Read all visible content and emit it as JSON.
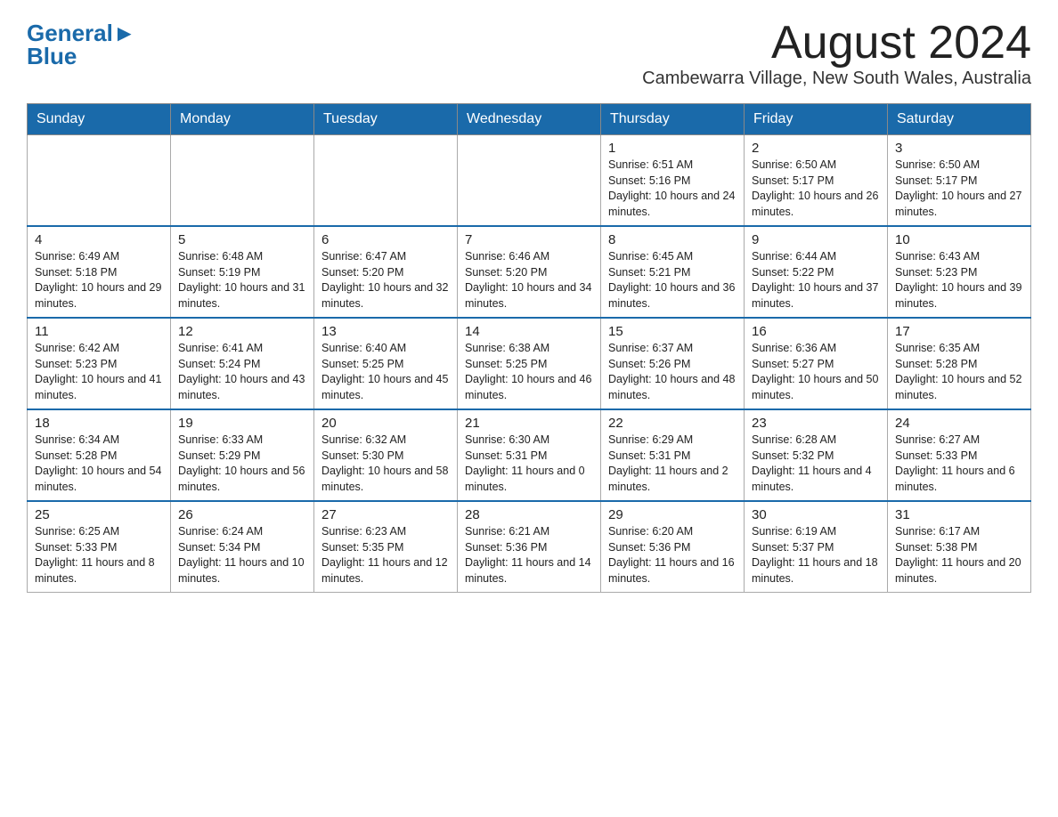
{
  "header": {
    "logo_general": "General",
    "logo_blue": "Blue",
    "month_title": "August 2024",
    "location": "Cambewarra Village, New South Wales, Australia"
  },
  "days_of_week": [
    "Sunday",
    "Monday",
    "Tuesday",
    "Wednesday",
    "Thursday",
    "Friday",
    "Saturday"
  ],
  "weeks": [
    [
      {
        "day": "",
        "info": ""
      },
      {
        "day": "",
        "info": ""
      },
      {
        "day": "",
        "info": ""
      },
      {
        "day": "",
        "info": ""
      },
      {
        "day": "1",
        "info": "Sunrise: 6:51 AM\nSunset: 5:16 PM\nDaylight: 10 hours and 24 minutes."
      },
      {
        "day": "2",
        "info": "Sunrise: 6:50 AM\nSunset: 5:17 PM\nDaylight: 10 hours and 26 minutes."
      },
      {
        "day": "3",
        "info": "Sunrise: 6:50 AM\nSunset: 5:17 PM\nDaylight: 10 hours and 27 minutes."
      }
    ],
    [
      {
        "day": "4",
        "info": "Sunrise: 6:49 AM\nSunset: 5:18 PM\nDaylight: 10 hours and 29 minutes."
      },
      {
        "day": "5",
        "info": "Sunrise: 6:48 AM\nSunset: 5:19 PM\nDaylight: 10 hours and 31 minutes."
      },
      {
        "day": "6",
        "info": "Sunrise: 6:47 AM\nSunset: 5:20 PM\nDaylight: 10 hours and 32 minutes."
      },
      {
        "day": "7",
        "info": "Sunrise: 6:46 AM\nSunset: 5:20 PM\nDaylight: 10 hours and 34 minutes."
      },
      {
        "day": "8",
        "info": "Sunrise: 6:45 AM\nSunset: 5:21 PM\nDaylight: 10 hours and 36 minutes."
      },
      {
        "day": "9",
        "info": "Sunrise: 6:44 AM\nSunset: 5:22 PM\nDaylight: 10 hours and 37 minutes."
      },
      {
        "day": "10",
        "info": "Sunrise: 6:43 AM\nSunset: 5:23 PM\nDaylight: 10 hours and 39 minutes."
      }
    ],
    [
      {
        "day": "11",
        "info": "Sunrise: 6:42 AM\nSunset: 5:23 PM\nDaylight: 10 hours and 41 minutes."
      },
      {
        "day": "12",
        "info": "Sunrise: 6:41 AM\nSunset: 5:24 PM\nDaylight: 10 hours and 43 minutes."
      },
      {
        "day": "13",
        "info": "Sunrise: 6:40 AM\nSunset: 5:25 PM\nDaylight: 10 hours and 45 minutes."
      },
      {
        "day": "14",
        "info": "Sunrise: 6:38 AM\nSunset: 5:25 PM\nDaylight: 10 hours and 46 minutes."
      },
      {
        "day": "15",
        "info": "Sunrise: 6:37 AM\nSunset: 5:26 PM\nDaylight: 10 hours and 48 minutes."
      },
      {
        "day": "16",
        "info": "Sunrise: 6:36 AM\nSunset: 5:27 PM\nDaylight: 10 hours and 50 minutes."
      },
      {
        "day": "17",
        "info": "Sunrise: 6:35 AM\nSunset: 5:28 PM\nDaylight: 10 hours and 52 minutes."
      }
    ],
    [
      {
        "day": "18",
        "info": "Sunrise: 6:34 AM\nSunset: 5:28 PM\nDaylight: 10 hours and 54 minutes."
      },
      {
        "day": "19",
        "info": "Sunrise: 6:33 AM\nSunset: 5:29 PM\nDaylight: 10 hours and 56 minutes."
      },
      {
        "day": "20",
        "info": "Sunrise: 6:32 AM\nSunset: 5:30 PM\nDaylight: 10 hours and 58 minutes."
      },
      {
        "day": "21",
        "info": "Sunrise: 6:30 AM\nSunset: 5:31 PM\nDaylight: 11 hours and 0 minutes."
      },
      {
        "day": "22",
        "info": "Sunrise: 6:29 AM\nSunset: 5:31 PM\nDaylight: 11 hours and 2 minutes."
      },
      {
        "day": "23",
        "info": "Sunrise: 6:28 AM\nSunset: 5:32 PM\nDaylight: 11 hours and 4 minutes."
      },
      {
        "day": "24",
        "info": "Sunrise: 6:27 AM\nSunset: 5:33 PM\nDaylight: 11 hours and 6 minutes."
      }
    ],
    [
      {
        "day": "25",
        "info": "Sunrise: 6:25 AM\nSunset: 5:33 PM\nDaylight: 11 hours and 8 minutes."
      },
      {
        "day": "26",
        "info": "Sunrise: 6:24 AM\nSunset: 5:34 PM\nDaylight: 11 hours and 10 minutes."
      },
      {
        "day": "27",
        "info": "Sunrise: 6:23 AM\nSunset: 5:35 PM\nDaylight: 11 hours and 12 minutes."
      },
      {
        "day": "28",
        "info": "Sunrise: 6:21 AM\nSunset: 5:36 PM\nDaylight: 11 hours and 14 minutes."
      },
      {
        "day": "29",
        "info": "Sunrise: 6:20 AM\nSunset: 5:36 PM\nDaylight: 11 hours and 16 minutes."
      },
      {
        "day": "30",
        "info": "Sunrise: 6:19 AM\nSunset: 5:37 PM\nDaylight: 11 hours and 18 minutes."
      },
      {
        "day": "31",
        "info": "Sunrise: 6:17 AM\nSunset: 5:38 PM\nDaylight: 11 hours and 20 minutes."
      }
    ]
  ]
}
